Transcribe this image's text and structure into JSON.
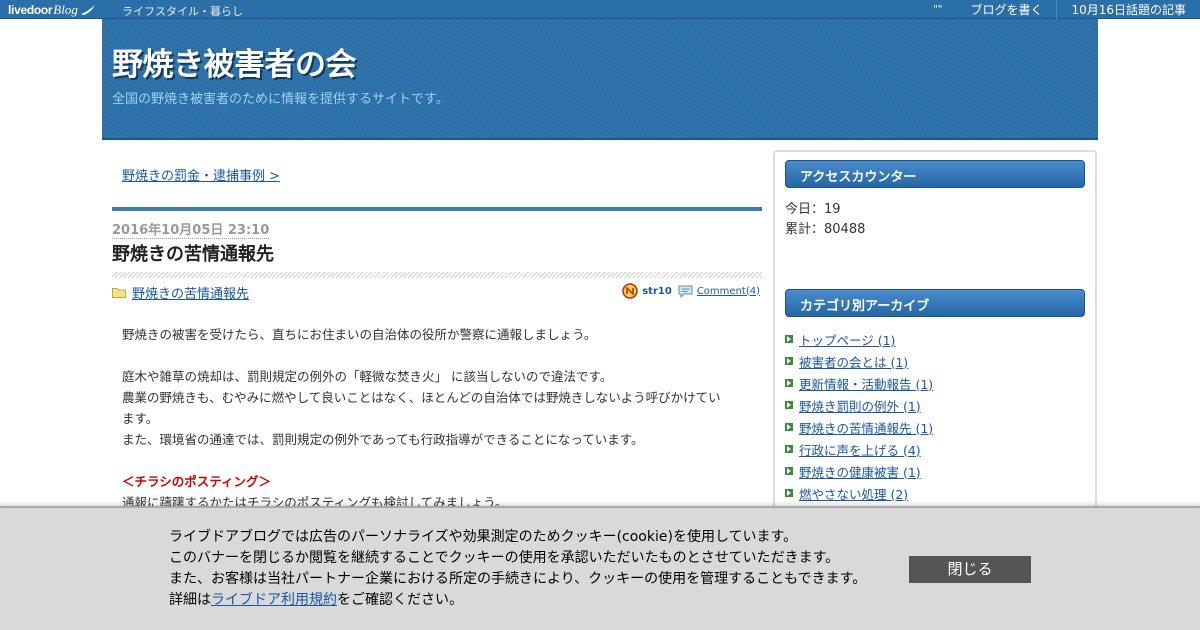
{
  "topbar": {
    "logo_text": "livedoor",
    "logo_blog": "Blog",
    "category": "ライフスタイル・暮らし",
    "dots": "\"\"",
    "write_blog": "ブログを書く",
    "trending": "10月16日話題の記事"
  },
  "header": {
    "title": "野焼き被害者の会",
    "description": "全国の野焼き被害者のために情報を提供するサイトです。"
  },
  "main": {
    "prev_link": "野焼きの罰金・逮捕事例 >",
    "entry": {
      "date": "2016年10月05日 23:10",
      "title": "野焼きの苦情通報先",
      "category": "野焼きの苦情通報先",
      "author": "str10",
      "comments": "Comment(4)",
      "body": [
        "野焼きの被害を受けたら、直ちにお住まいの自治体の役所か警察に通報しましょう。",
        "",
        "庭木や雑草の焼却は、罰則規定の例外の「軽微な焚き火」 に該当しないので違法です。",
        "農業の野焼きも、むやみに燃やして良いことはなく、ほとんどの自治体では野焼きしないよう呼びかけてい",
        "ます。",
        "また、環境省の通達では、罰則規定の例外であっても行政指導ができることになっています。",
        "",
        "＜チラシのポスティング＞",
        "通報に躊躇するかたはチラシのポスティングも検討してみましょう。"
      ]
    }
  },
  "sidebar": {
    "counter": {
      "heading": "アクセスカウンター",
      "today": "今日：19",
      "total": "累計：80488"
    },
    "categories": {
      "heading": "カテゴリ別アーカイブ",
      "items": [
        "トップページ (1)",
        "被害者の会とは (1)",
        "更新情報・活動報告 (1)",
        "野焼き罰則の例外 (1)",
        "野焼きの苦情通報先 (1)",
        "行政に声を上げる (4)",
        "野焼きの健康被害 (1)",
        "燃やさない処理 (2)"
      ]
    }
  },
  "cookie": {
    "line1": "ライブドアブログでは広告のパーソナライズや効果測定のためクッキー(cookie)を使用しています。",
    "line2": "このバナーを閉じるか閲覧を継続することでクッキーの使用を承認いただいたものとさせていただきます。",
    "line3": "また、お客様は当社パートナー企業における所定の手続きにより、クッキーの使用を管理することもできます。",
    "line4_prefix": "詳細は",
    "line4_link": "ライブドア利用規約",
    "line4_suffix": "をご確認ください。",
    "close_label": "閉じる"
  },
  "colors": {
    "brand_blue": "#2a6fa8",
    "link": "#1a58a3",
    "red_heading": "#d40000",
    "bullet_green": "#3b8b3b",
    "banner_bg": "#d9d9d9",
    "close_button": "#555555"
  },
  "icons": [
    "livedoor-blog-logo",
    "folder-icon",
    "author-icon",
    "comment-icon",
    "bullet-arrow-icon"
  ]
}
